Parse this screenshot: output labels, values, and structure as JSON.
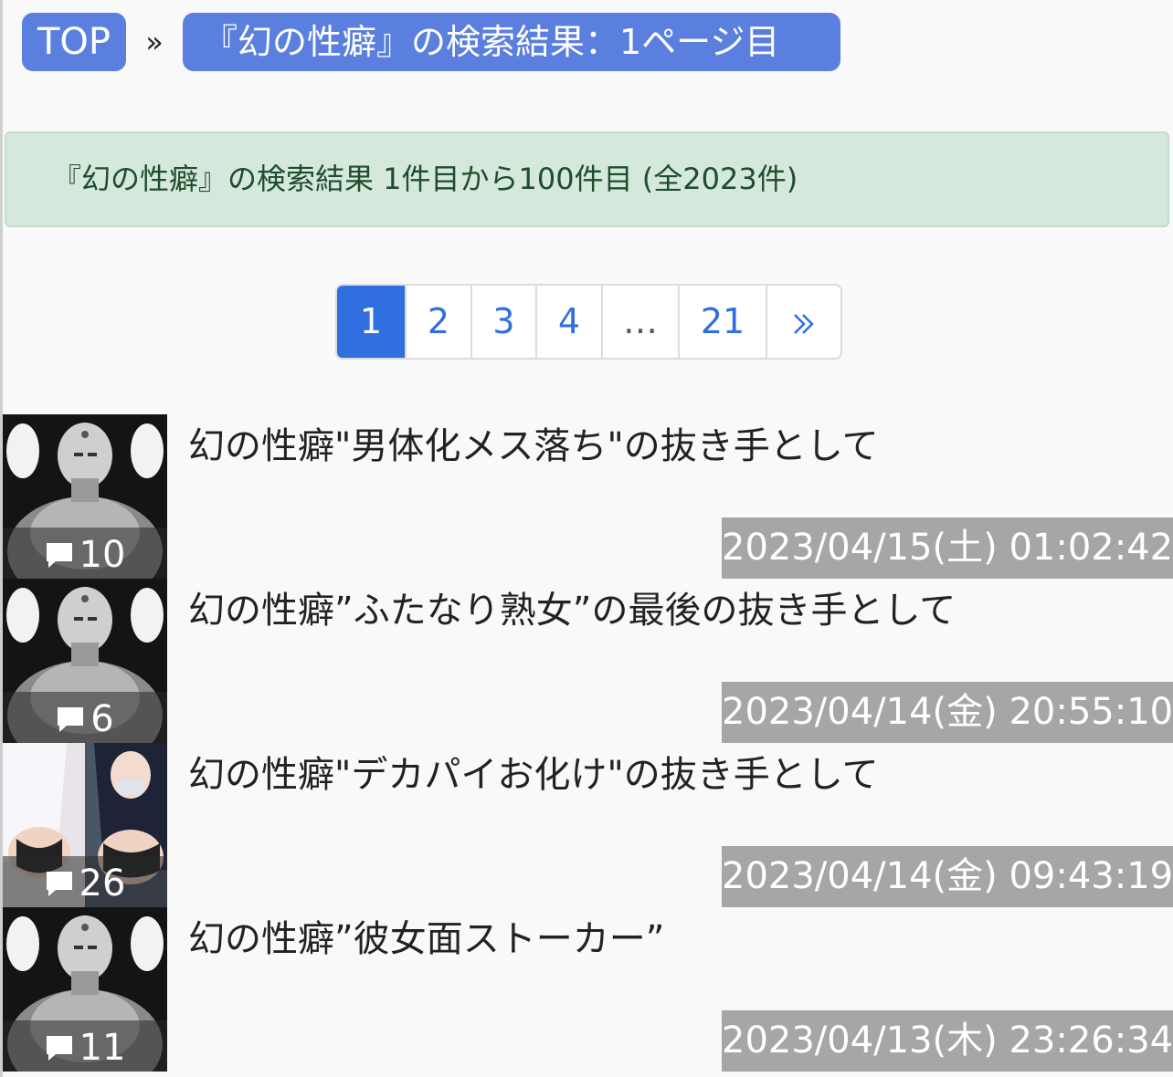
{
  "breadcrumb": {
    "top_label": "TOP",
    "separator": "»",
    "current_label": "『幻の性癖』の検索結果：1ページ目"
  },
  "result_summary": "『幻の性癖』の検索結果 1件目から100件目 (全2023件)",
  "pagination": {
    "pages": [
      "1",
      "2",
      "3",
      "4",
      "…",
      "21"
    ],
    "active": "1",
    "next_icon": "double-chevron-right-icon"
  },
  "posts": [
    {
      "title": "幻の性癖\"男体化メス落ち\"の抜き手として",
      "comments": "10",
      "date": "2023/04/15(土) 01:02:42",
      "thumbnail": "monk-manga-illustration"
    },
    {
      "title": "幻の性癖”ふたなり熟女”の最後の抜き手として",
      "comments": "6",
      "date": "2023/04/14(金) 20:55:10",
      "thumbnail": "monk-manga-illustration"
    },
    {
      "title": "幻の性癖\"デカパイお化け\"の抜き手として",
      "comments": "26",
      "date": "2023/04/14(金) 09:43:19",
      "thumbnail": "anime-illustration"
    },
    {
      "title": "幻の性癖”彼女面ストーカー”",
      "comments": "11",
      "date": "2023/04/13(木) 23:26:34",
      "thumbnail": "monk-manga-illustration"
    }
  ],
  "colors": {
    "crumb_bg": "#5b7fde",
    "alert_bg": "#d5e8dc",
    "alert_text": "#1f4d2b",
    "page_active": "#2f6fe0",
    "date_bg": "#a6a6a6"
  }
}
